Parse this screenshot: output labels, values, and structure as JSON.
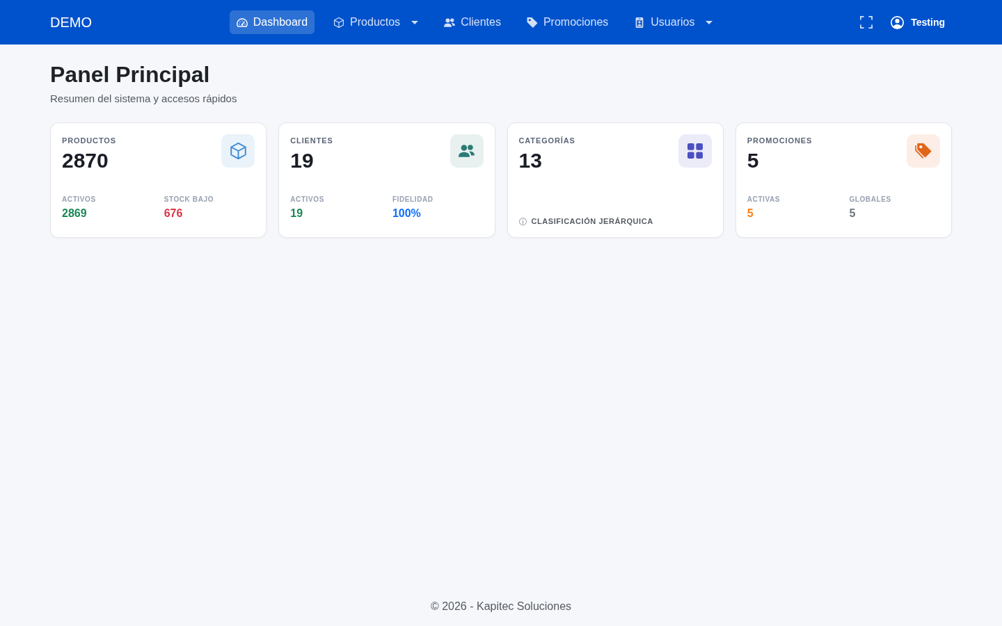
{
  "navbar": {
    "brand": "DEMO",
    "items": [
      {
        "label": "Dashboard",
        "selected": true,
        "dropdown": false
      },
      {
        "label": "Productos",
        "selected": false,
        "dropdown": true
      },
      {
        "label": "Clientes",
        "selected": false,
        "dropdown": false
      },
      {
        "label": "Promociones",
        "selected": false,
        "dropdown": false
      },
      {
        "label": "Usuarios",
        "selected": false,
        "dropdown": true
      }
    ],
    "user": "Testing"
  },
  "header": {
    "title": "Panel Principal",
    "subtitle": "Resumen del sistema y accesos rápidos"
  },
  "cards": [
    {
      "kind": "stats",
      "title": "PRODUCTOS",
      "value": "2870",
      "color": "#3d8bd4",
      "stats": [
        {
          "label": "ACTIVOS",
          "value": "2869",
          "color": "#198754"
        },
        {
          "label": "STOCK BAJO",
          "value": "676",
          "color": "#dc3545"
        }
      ]
    },
    {
      "kind": "stats",
      "title": "CLIENTES",
      "value": "19",
      "color": "#2a7b73",
      "stats": [
        {
          "label": "ACTIVOS",
          "value": "19",
          "color": "#198754"
        },
        {
          "label": "FIDELIDAD",
          "value": "100%",
          "color": "#0d6efd"
        }
      ]
    },
    {
      "kind": "note",
      "title": "CATEGORÍAS",
      "value": "13",
      "color": "#4a4fc2",
      "note": "CLASIFICACIÓN JERÁRQUICA"
    },
    {
      "kind": "stats",
      "title": "PROMOCIONES",
      "value": "5",
      "color": "#e0661b",
      "stats": [
        {
          "label": "ACTIVAS",
          "value": "5",
          "color": "#fd7e14"
        },
        {
          "label": "GLOBALES",
          "value": "5",
          "color": "#6c757d"
        }
      ]
    }
  ],
  "footer": "© 2026 - Kapitec Soluciones"
}
